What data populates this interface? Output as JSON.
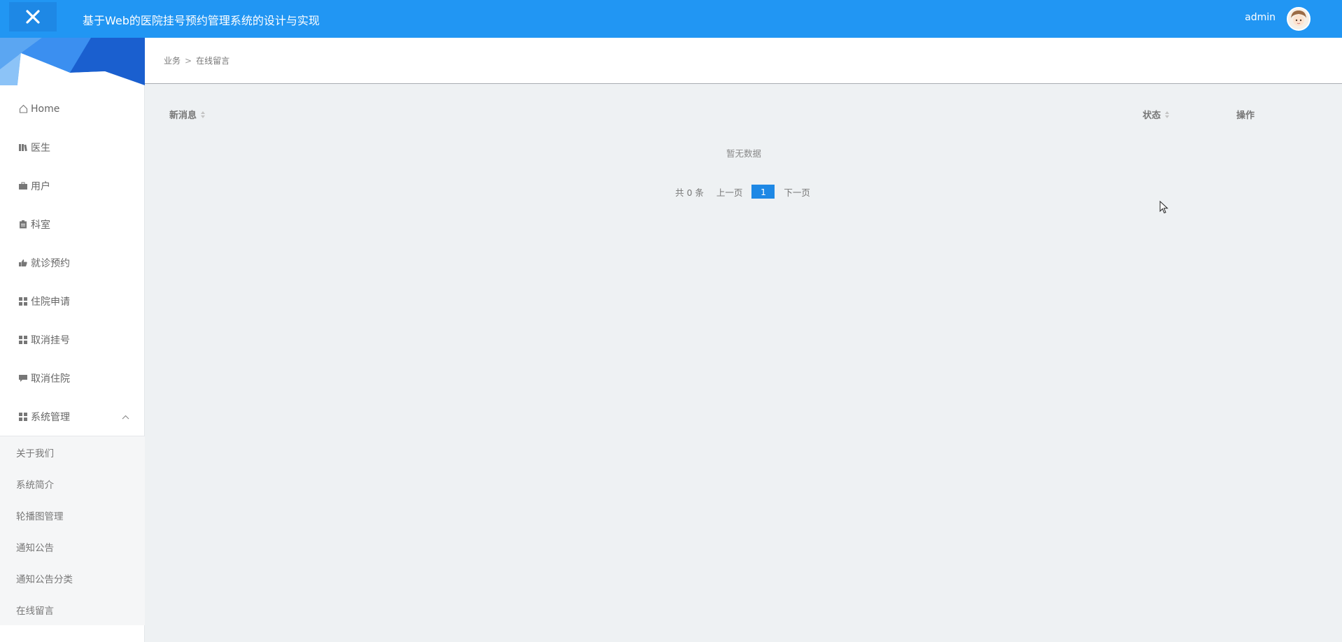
{
  "header": {
    "title": "基于Web的医院挂号预约管理系统的设计与实现",
    "user": "admin"
  },
  "sidebar": {
    "items": [
      {
        "label": "Home",
        "icon": "home-icon"
      },
      {
        "label": "医生",
        "icon": "books-icon"
      },
      {
        "label": "用户",
        "icon": "briefcase-icon"
      },
      {
        "label": "科室",
        "icon": "clipboard-icon"
      },
      {
        "label": "就诊预约",
        "icon": "thumbs-icon"
      },
      {
        "label": "住院申请",
        "icon": "grid-icon"
      },
      {
        "label": "取消挂号",
        "icon": "grid-icon"
      },
      {
        "label": "取消住院",
        "icon": "comment-icon"
      },
      {
        "label": "系统管理",
        "icon": "grid-icon",
        "expanded": true
      }
    ],
    "submenu": [
      {
        "label": "关于我们"
      },
      {
        "label": "系统简介"
      },
      {
        "label": "轮播图管理"
      },
      {
        "label": "通知公告"
      },
      {
        "label": "通知公告分类"
      },
      {
        "label": "在线留言"
      }
    ]
  },
  "breadcrumb": {
    "parent": "业务",
    "separator": ">",
    "current": "在线留言"
  },
  "table": {
    "columns": [
      "新消息",
      "状态",
      "操作"
    ],
    "empty_text": "暂无数据"
  },
  "pagination": {
    "total_text": "共 0 条",
    "prev": "上一页",
    "current_page": "1",
    "next": "下一页"
  },
  "colors": {
    "accent": "#2196f3",
    "page_button": "#1e88e5",
    "background": "#eef1f3"
  }
}
